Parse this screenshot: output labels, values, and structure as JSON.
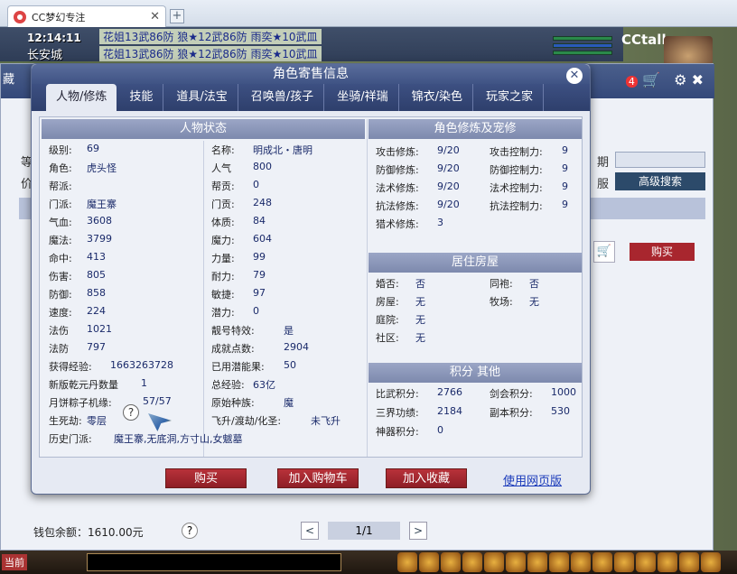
{
  "browser": {
    "tab_title": "CC梦幻专注",
    "close": "✕",
    "new_tab": "+"
  },
  "game": {
    "time": "12:14:11",
    "city": "长安城",
    "chat_line1": "花姐13武86防  狼★12武86防  雨奕★10武皿   ",
    "chat_line2": "花姐13武86防  狼★12武86防  雨奕★10武皿",
    "logo": "CCtalks",
    "left_chars": [
      "藏",
      "等",
      "价"
    ],
    "right_label1": "期",
    "right_label2": "服",
    "badge": "4",
    "bottom_label": "当前"
  },
  "outer": {
    "advanced_search": "高级搜索",
    "buy": "购买",
    "wallet": "钱包余额：1610.00元",
    "help": "?",
    "page": "1/1",
    "prev": "<",
    "next": ">",
    "cart_icon": "🛒"
  },
  "dialog": {
    "title": "角色寄售信息",
    "close": "✕",
    "tabs": [
      "人物/修炼",
      "技能",
      "道具/法宝",
      "召唤兽/孩子",
      "坐骑/祥瑞",
      "锦衣/染色",
      "玩家之家"
    ],
    "active_tab": 0,
    "sections": {
      "status": "人物状态",
      "cultivation": "角色修炼及宠修",
      "housing": "居住房屋",
      "points": "积分 其他"
    },
    "status_left": [
      {
        "label": "级别:",
        "value": "69"
      },
      {
        "label": "角色:",
        "value": "虎头怪"
      },
      {
        "label": "帮派:",
        "value": ""
      },
      {
        "label": "门派:",
        "value": "魔王寨"
      },
      {
        "label": "气血:",
        "value": "3608"
      },
      {
        "label": "魔法:",
        "value": "3799"
      },
      {
        "label": "命中:",
        "value": "413"
      },
      {
        "label": "伤害:",
        "value": "805"
      },
      {
        "label": "防御:",
        "value": "858"
      },
      {
        "label": "速度:",
        "value": "224"
      },
      {
        "label": "法伤",
        "value": "1021"
      },
      {
        "label": "法防",
        "value": "797"
      },
      {
        "label": "获得经验:",
        "value": "1663263728"
      },
      {
        "label": "新版乾元丹数量",
        "value": "1"
      },
      {
        "label": "月饼粽子机缘:",
        "value": "57/57"
      },
      {
        "label": "生死劫:",
        "value": "零层"
      },
      {
        "label": "历史门派:",
        "value": "魔王寨,无底洞,方寸山,女魃墓"
      }
    ],
    "status_right": [
      {
        "label": "名称:",
        "value": "明成北・唐明"
      },
      {
        "label": "人气",
        "value": "800"
      },
      {
        "label": "帮贡:",
        "value": "0"
      },
      {
        "label": "门贡:",
        "value": "248"
      },
      {
        "label": "体质:",
        "value": "84"
      },
      {
        "label": "魔力:",
        "value": "604"
      },
      {
        "label": "力量:",
        "value": "99"
      },
      {
        "label": "耐力:",
        "value": "79"
      },
      {
        "label": "敏捷:",
        "value": "97"
      },
      {
        "label": "潜力:",
        "value": "0"
      },
      {
        "label": "靓号特效:",
        "value": "是"
      },
      {
        "label": "成就点数:",
        "value": "2904"
      },
      {
        "label": "已用潜能果:",
        "value": "50"
      },
      {
        "label": "总经验:",
        "value": "63亿"
      },
      {
        "label": "原始种族:",
        "value": "魔"
      },
      {
        "label": "飞升/渡劫/化圣:",
        "value": "未飞升"
      }
    ],
    "cultivation": [
      {
        "label": "攻击修炼:",
        "value": "9/20",
        "label2": "攻击控制力:",
        "value2": "9"
      },
      {
        "label": "防御修炼:",
        "value": "9/20",
        "label2": "防御控制力:",
        "value2": "9"
      },
      {
        "label": "法术修炼:",
        "value": "9/20",
        "label2": "法术控制力:",
        "value2": "9"
      },
      {
        "label": "抗法修炼:",
        "value": "9/20",
        "label2": "抗法控制力:",
        "value2": "9"
      },
      {
        "label": "猎术修炼:",
        "value": "3",
        "label2": "",
        "value2": ""
      }
    ],
    "housing": [
      {
        "label": "婚否:",
        "value": "否",
        "label2": "同袍:",
        "value2": "否"
      },
      {
        "label": "房屋:",
        "value": "无",
        "label2": "牧场:",
        "value2": "无"
      },
      {
        "label": "庭院:",
        "value": "无",
        "label2": "",
        "value2": ""
      },
      {
        "label": "社区:",
        "value": "无",
        "label2": "",
        "value2": ""
      }
    ],
    "points": [
      {
        "label": "比武积分:",
        "value": "2766",
        "label2": "剑会积分:",
        "value2": "1000"
      },
      {
        "label": "三界功绩:",
        "value": "2184",
        "label2": "副本积分:",
        "value2": "530"
      },
      {
        "label": "神器积分:",
        "value": "0",
        "label2": "",
        "value2": ""
      }
    ],
    "help": "?",
    "buttons": {
      "buy": "购买",
      "add_cart": "加入购物车",
      "favorite": "加入收藏",
      "web": "使用网页版"
    }
  }
}
